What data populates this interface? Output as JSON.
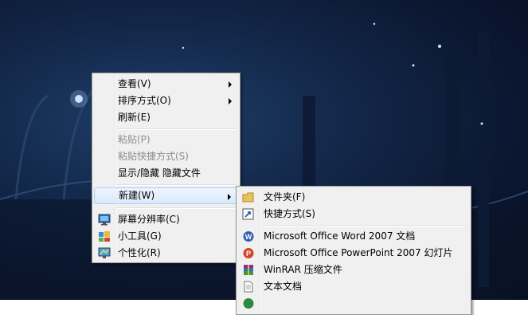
{
  "context_menu": {
    "items": [
      {
        "label": "查看(V)"
      },
      {
        "label": "排序方式(O)"
      },
      {
        "label": "刷新(E)"
      },
      {
        "label": "粘贴(P)"
      },
      {
        "label": "粘贴快捷方式(S)"
      },
      {
        "label": "显示/隐藏 隐藏文件"
      },
      {
        "label": "新建(W)"
      },
      {
        "label": "屏幕分辨率(C)"
      },
      {
        "label": "小工具(G)"
      },
      {
        "label": "个性化(R)"
      }
    ]
  },
  "new_submenu": {
    "items": [
      {
        "label": "文件夹(F)",
        "icon": "folder-icon"
      },
      {
        "label": "快捷方式(S)",
        "icon": "shortcut-icon"
      },
      {
        "label": "Microsoft Office Word 2007 文档",
        "icon": "word-icon"
      },
      {
        "label": "Microsoft Office PowerPoint 2007 幻灯片",
        "icon": "powerpoint-icon"
      },
      {
        "label": "WinRAR 压缩文件",
        "icon": "winrar-icon"
      },
      {
        "label": "文本文档",
        "icon": "text-document-icon"
      }
    ]
  },
  "colors": {
    "menu_bg": "#f0f0f0",
    "highlight": "#d9e9fb",
    "disabled_text": "#8d8d8d"
  }
}
